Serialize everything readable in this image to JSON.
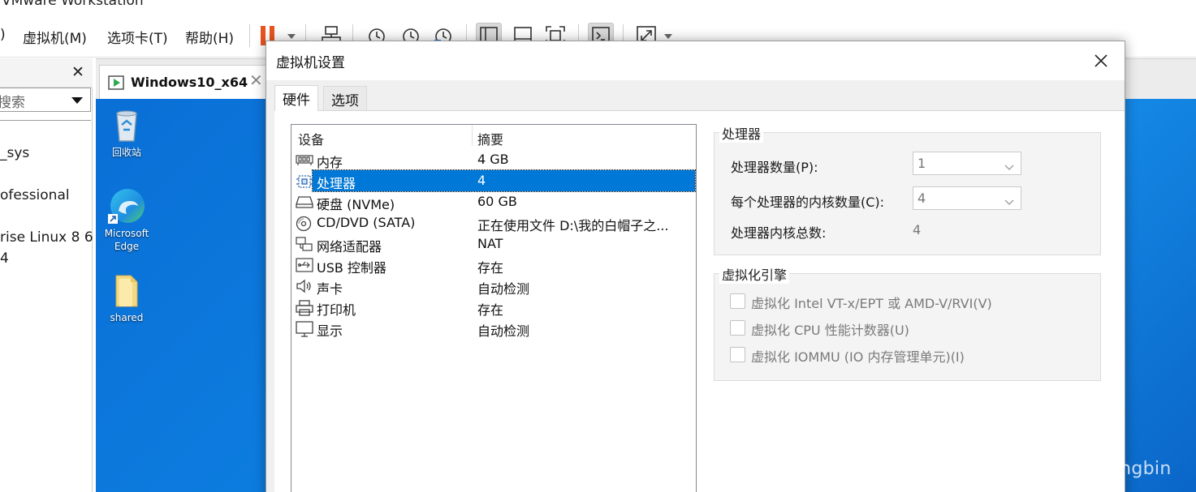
{
  "app": {
    "title": "VMware Workstation"
  },
  "menu": {
    "partial_left": ")",
    "vm": "虚拟机(M)",
    "tabs": "选项卡(T)",
    "help": "帮助(H)"
  },
  "toolbar": {
    "icons": [
      "pause-icon",
      "send-keys-icon",
      "snapshot-icon",
      "revert-snapshot-icon",
      "snapshot-manager-icon",
      "console-view-icon",
      "thumbnail-view-icon",
      "fullscreen-icon",
      "terminal-icon",
      "stretch-icon"
    ]
  },
  "library": {
    "search_placeholder": "搜索",
    "items": [
      "_sys",
      "ofessional",
      "rise Linux 8 6",
      "4"
    ]
  },
  "vm_tab": {
    "label": "Windows10_x64"
  },
  "desktop": {
    "icons": [
      {
        "label": "回收站",
        "icon": "recycle-bin-icon"
      },
      {
        "label": "Microsoft Edge",
        "icon": "edge-icon"
      },
      {
        "label": "shared",
        "icon": "folder-icon"
      }
    ]
  },
  "dialog": {
    "title": "虚拟机设置",
    "tabs": [
      {
        "label": "硬件",
        "active": true
      },
      {
        "label": "选项",
        "active": false
      }
    ],
    "device_list": {
      "headers": [
        "设备",
        "摘要"
      ],
      "rows": [
        {
          "icon": "memory-icon",
          "name": "内存",
          "summary": "4 GB",
          "selected": false
        },
        {
          "icon": "processor-icon",
          "name": "处理器",
          "summary": "4",
          "selected": true
        },
        {
          "icon": "disk-icon",
          "name": "硬盘 (NVMe)",
          "summary": "60 GB",
          "selected": false
        },
        {
          "icon": "cdrom-icon",
          "name": "CD/DVD (SATA)",
          "summary": "正在使用文件 D:\\我的白帽子之...",
          "selected": false
        },
        {
          "icon": "network-icon",
          "name": "网络适配器",
          "summary": "NAT",
          "selected": false
        },
        {
          "icon": "usb-icon",
          "name": "USB 控制器",
          "summary": "存在",
          "selected": false
        },
        {
          "icon": "sound-icon",
          "name": "声卡",
          "summary": "自动检测",
          "selected": false
        },
        {
          "icon": "printer-icon",
          "name": "打印机",
          "summary": "存在",
          "selected": false
        },
        {
          "icon": "display-icon",
          "name": "显示",
          "summary": "自动检测",
          "selected": false
        }
      ]
    },
    "processor": {
      "group_title": "处理器",
      "count_label": "处理器数量(P):",
      "count_value": "1",
      "cores_label": "每个处理器的内核数量(C):",
      "cores_value": "4",
      "total_label": "处理器内核总数:",
      "total_value": "4"
    },
    "virtualization": {
      "group_title": "虚拟化引擎",
      "options": [
        {
          "label": "虚拟化 Intel VT-x/EPT 或 AMD-V/RVI(V)",
          "checked": false
        },
        {
          "label": "虚拟化 CPU 性能计数器(U)",
          "checked": false
        },
        {
          "label": "虚拟化 IOMMU (IO 内存管理单元)(I)",
          "checked": false
        }
      ]
    }
  },
  "watermark": "CSDN @liangxiangbin",
  "colors": {
    "selection": "#0078d7",
    "desktop": "#0d7de0",
    "pause_accent": "#e8541e"
  }
}
